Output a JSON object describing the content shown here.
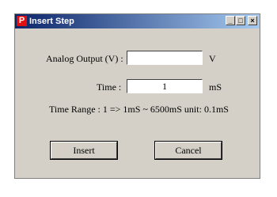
{
  "window": {
    "app_icon_letter": "P",
    "title": "Insert Step",
    "controls": {
      "minimize": "_",
      "maximize": "□",
      "close": "×"
    }
  },
  "form": {
    "analog_output_label": "Analog Output (V) :",
    "analog_output_value": "",
    "analog_output_unit": "V",
    "time_label": "Time :",
    "time_value": "1",
    "time_unit": "mS",
    "time_range_text": "Time Range :  1 => 1mS ~ 6500mS unit: 0.1mS"
  },
  "buttons": {
    "insert": "Insert",
    "cancel": "Cancel"
  }
}
